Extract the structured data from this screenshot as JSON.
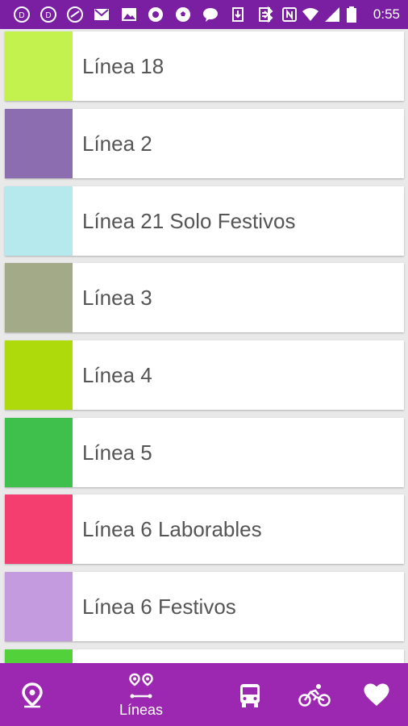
{
  "status_bar": {
    "time": "0:55",
    "icons": [
      "notification-icon",
      "notification-icon",
      "notification-icon",
      "gmail-icon",
      "image-icon",
      "circle-icon",
      "soccer-icon",
      "chat-icon",
      "download-icon",
      "clipboard-icon",
      "bluetooth-icon",
      "nfc-icon",
      "wifi-icon",
      "signal-icon",
      "battery-icon"
    ]
  },
  "lines": [
    {
      "name": "Línea 18",
      "color": "#c3f14e"
    },
    {
      "name": "Línea 2",
      "color": "#8c6db0"
    },
    {
      "name": "Línea 21 Solo Festivos",
      "color": "#b5e9ee"
    },
    {
      "name": "Línea 3",
      "color": "#a3aa87"
    },
    {
      "name": "Línea 4",
      "color": "#aed90a"
    },
    {
      "name": "Línea 5",
      "color": "#3fbf4c"
    },
    {
      "name": "Línea 6 Laborables",
      "color": "#f33e6f"
    },
    {
      "name": "Línea 6 Festivos",
      "color": "#c59be0"
    },
    {
      "name": "",
      "color": "#52d13a"
    }
  ],
  "bottom_nav": {
    "items": [
      {
        "icon": "location-pin-icon",
        "label": ""
      },
      {
        "icon": "route-icon",
        "label": "Líneas"
      },
      {
        "icon": "bus-icon",
        "label": ""
      },
      {
        "icon": "bicycle-icon",
        "label": ""
      },
      {
        "icon": "heart-icon",
        "label": ""
      }
    ],
    "active_index": 1
  },
  "colors": {
    "status_bar": "#7b1fa2",
    "bottom_nav": "#9c27b0",
    "background": "#e9e9e9"
  }
}
